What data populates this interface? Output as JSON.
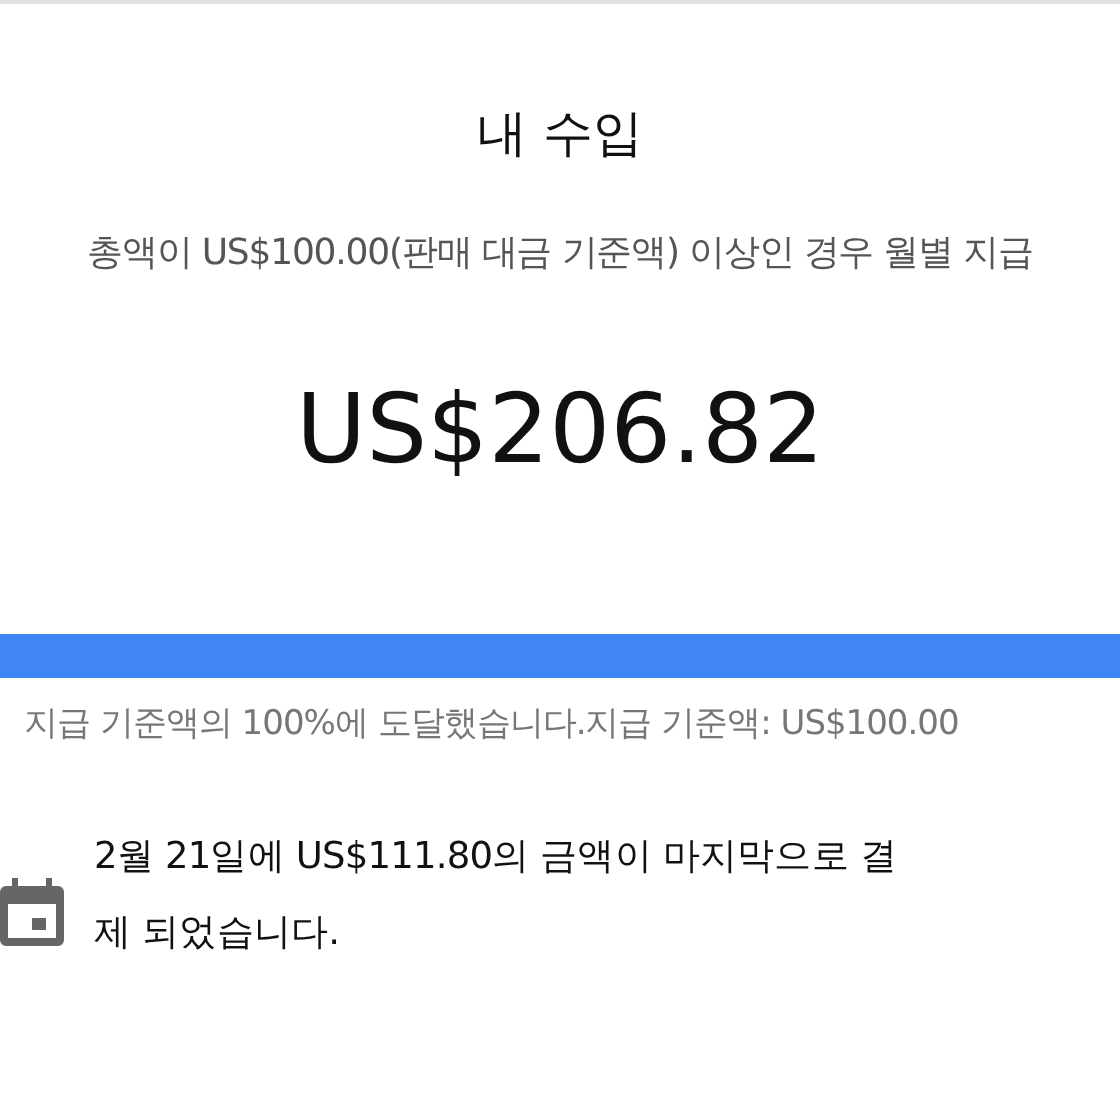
{
  "title": "내 수입",
  "threshold_note": "총액이 US$100.00(판매 대금 기준액) 이상인 경우 월별 지급",
  "balance": "US$206.82",
  "progress": {
    "level": 1.0,
    "caption": "지급 기준액의 100%에 도달했습니다.지급 기준액: US$100.00"
  },
  "last_payment": "2월 21일에 US$111.80의 금액이 마지막으로 결제 되었습니다."
}
